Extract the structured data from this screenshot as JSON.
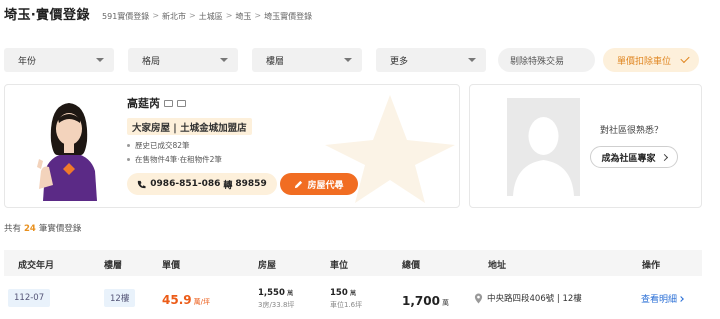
{
  "header": {
    "title": "埼玉‧實價登錄",
    "breadcrumb": [
      "591實價登錄",
      "新北市",
      "土城區",
      "埼玉",
      "埼玉實價登錄"
    ],
    "breadcrumb_sep": ">"
  },
  "filters": {
    "selects": [
      "年份",
      "格局",
      "樓層",
      "更多"
    ],
    "exclude_special": "剔除特殊交易",
    "exclude_parking": "單價扣除車位"
  },
  "agent": {
    "name": "高莚芮",
    "company": "大家房屋 | 土城金城加盟店",
    "stat_sold": "歷史已成交82筆",
    "stat_listing": "在售物件4筆·在租物件2筆",
    "phone": "0986-851-086",
    "ext_sep": "轉",
    "ext": "89859",
    "commission_button": "房屋代尋"
  },
  "expert": {
    "question": "對社區很熟悉？",
    "button": "成為社區專家"
  },
  "summary": {
    "prefix": "共有",
    "count": "24",
    "suffix": "筆實價登錄"
  },
  "table": {
    "headers": [
      "成交年月",
      "樓層",
      "單價",
      "房屋",
      "車位",
      "總價",
      "地址",
      "操作"
    ],
    "rows": [
      {
        "date": "112-07",
        "floor": "12樓",
        "unit_price": "45.9",
        "unit_price_unit": "萬/坪",
        "house_price": "1,550",
        "house_price_unit": "萬",
        "house_detail": "3房/33.8坪",
        "parking_price": "150",
        "parking_unit": "萬",
        "parking_detail": "車位1.6坪",
        "total": "1,700",
        "total_unit": "萬",
        "address": "中央路四段406號 | 12樓",
        "action": "查看明細"
      }
    ]
  },
  "colors": {
    "accent": "#f16d22",
    "highlight": "#e8901e",
    "link": "#2a6fd6"
  }
}
